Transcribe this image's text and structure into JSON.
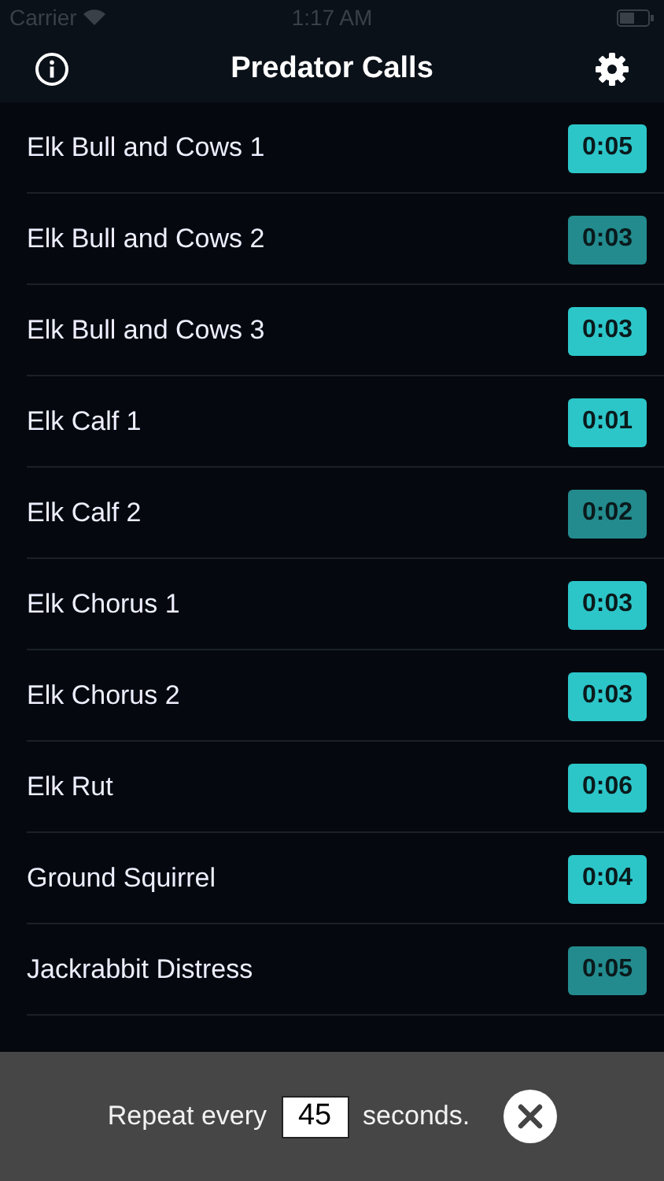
{
  "status_bar": {
    "carrier": "Carrier",
    "time": "1:17 AM"
  },
  "header": {
    "title": "Predator Calls"
  },
  "calls": [
    {
      "name": "Elk Bull and Cows 1",
      "duration": "0:05",
      "dimmed": false
    },
    {
      "name": "Elk Bull and Cows 2",
      "duration": "0:03",
      "dimmed": true
    },
    {
      "name": "Elk Bull and Cows 3",
      "duration": "0:03",
      "dimmed": false
    },
    {
      "name": "Elk Calf 1",
      "duration": "0:01",
      "dimmed": false
    },
    {
      "name": "Elk Calf 2",
      "duration": "0:02",
      "dimmed": true
    },
    {
      "name": "Elk Chorus 1",
      "duration": "0:03",
      "dimmed": false
    },
    {
      "name": "Elk Chorus 2",
      "duration": "0:03",
      "dimmed": false
    },
    {
      "name": "Elk Rut",
      "duration": "0:06",
      "dimmed": false
    },
    {
      "name": "Ground Squirrel",
      "duration": "0:04",
      "dimmed": false
    },
    {
      "name": "Jackrabbit Distress",
      "duration": "0:05",
      "dimmed": true
    }
  ],
  "repeat_bar": {
    "before": "Repeat every",
    "value": "45",
    "after": "seconds."
  }
}
